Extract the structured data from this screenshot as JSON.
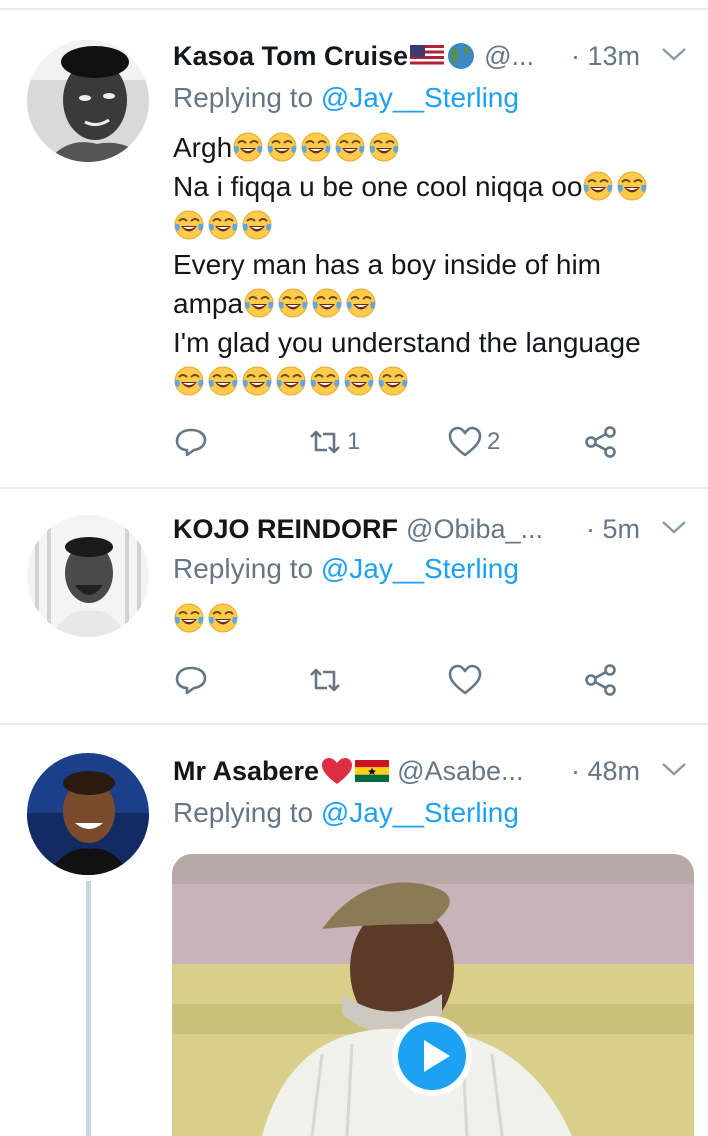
{
  "tweets": [
    {
      "name": "Kasoa Tom Cruise",
      "name_emojis": [
        "us-flag-icon",
        "globe-icon"
      ],
      "handle": "@...",
      "time": "· 13m",
      "replying_label": "Replying to",
      "replying_to": "@Jay__Sterling",
      "lines": [
        {
          "text": "Argh",
          "emojis": 5
        },
        {
          "text": "Na i fiqqa u be one cool niqqa oo",
          "emojis": 2
        },
        {
          "text": "",
          "emojis": 3
        },
        {
          "text": "Every man has a boy inside of him",
          "emojis": 0
        },
        {
          "text": "ampa",
          "emojis": 4
        },
        {
          "text": "I'm glad you understand the language",
          "emojis": 0
        },
        {
          "text": "",
          "emojis": 7
        }
      ],
      "replies": "",
      "retweets": "1",
      "likes": "2"
    },
    {
      "name": "KOJO REINDORF",
      "handle": "@Obiba_...",
      "time": "· 5m",
      "replying_label": "Replying to",
      "replying_to": "@Jay__Sterling",
      "lines": [
        {
          "text": "",
          "emojis": 2
        }
      ],
      "replies": "",
      "retweets": "",
      "likes": ""
    },
    {
      "name": "Mr Asabere",
      "name_emojis": [
        "red-heart-icon",
        "ghana-flag-icon"
      ],
      "handle": "@Asabe...",
      "time": "· 48m",
      "replying_label": "Replying to",
      "replying_to": "@Jay__Sterling",
      "media": {
        "type": "video",
        "icon": "play-icon"
      }
    }
  ],
  "colors": {
    "link": "#1da1f2",
    "secondary_text": "#657786",
    "divider": "#e6ecf0",
    "emoji_face": "#ffcb4c",
    "emoji_tear": "#5fa8e8"
  }
}
